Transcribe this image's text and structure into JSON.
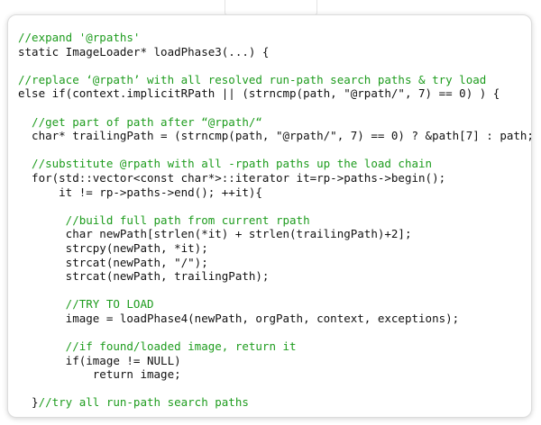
{
  "code": {
    "colors": {
      "comment": "#1e9c1e",
      "code": "#111111",
      "background": "#ffffff"
    },
    "lines": [
      {
        "type": "comment",
        "text": "//expand '@rpaths'"
      },
      {
        "type": "code",
        "text": "static ImageLoader* loadPhase3(...) {"
      },
      {
        "type": "blank",
        "text": ""
      },
      {
        "type": "comment",
        "text": "//replace ‘@rpath’ with all resolved run-path search paths & try load"
      },
      {
        "type": "code",
        "text": "else if(context.implicitRPath || (strncmp(path, \"@rpath/\", 7) == 0) ) {"
      },
      {
        "type": "blank",
        "text": ""
      },
      {
        "type": "comment",
        "text": "  //get part of path after “@rpath/“"
      },
      {
        "type": "code",
        "text": "  char* trailingPath = (strncmp(path, \"@rpath/\", 7) == 0) ? &path[7] : path;"
      },
      {
        "type": "blank",
        "text": ""
      },
      {
        "type": "comment",
        "text": "  //substitute @rpath with all -rpath paths up the load chain"
      },
      {
        "type": "code",
        "text": "  for(std::vector<const char*>::iterator it=rp->paths->begin();"
      },
      {
        "type": "code",
        "text": "      it != rp->paths->end(); ++it){"
      },
      {
        "type": "blank",
        "text": ""
      },
      {
        "type": "comment",
        "text": "       //build full path from current rpath"
      },
      {
        "type": "code",
        "text": "       char newPath[strlen(*it) + strlen(trailingPath)+2];"
      },
      {
        "type": "code",
        "text": "       strcpy(newPath, *it);"
      },
      {
        "type": "code",
        "text": "       strcat(newPath, \"/\");"
      },
      {
        "type": "code",
        "text": "       strcat(newPath, trailingPath);"
      },
      {
        "type": "blank",
        "text": ""
      },
      {
        "type": "comment",
        "text": "       //TRY TO LOAD"
      },
      {
        "type": "code",
        "text": "       image = loadPhase4(newPath, orgPath, context, exceptions);"
      },
      {
        "type": "blank",
        "text": ""
      },
      {
        "type": "comment",
        "text": "       //if found/loaded image, return it"
      },
      {
        "type": "code",
        "text": "       if(image != NULL)"
      },
      {
        "type": "code",
        "text": "           return image;"
      },
      {
        "type": "blank",
        "text": ""
      },
      {
        "type": "mixed",
        "text": "  }",
        "comment": "//try all run-path search paths"
      }
    ]
  }
}
